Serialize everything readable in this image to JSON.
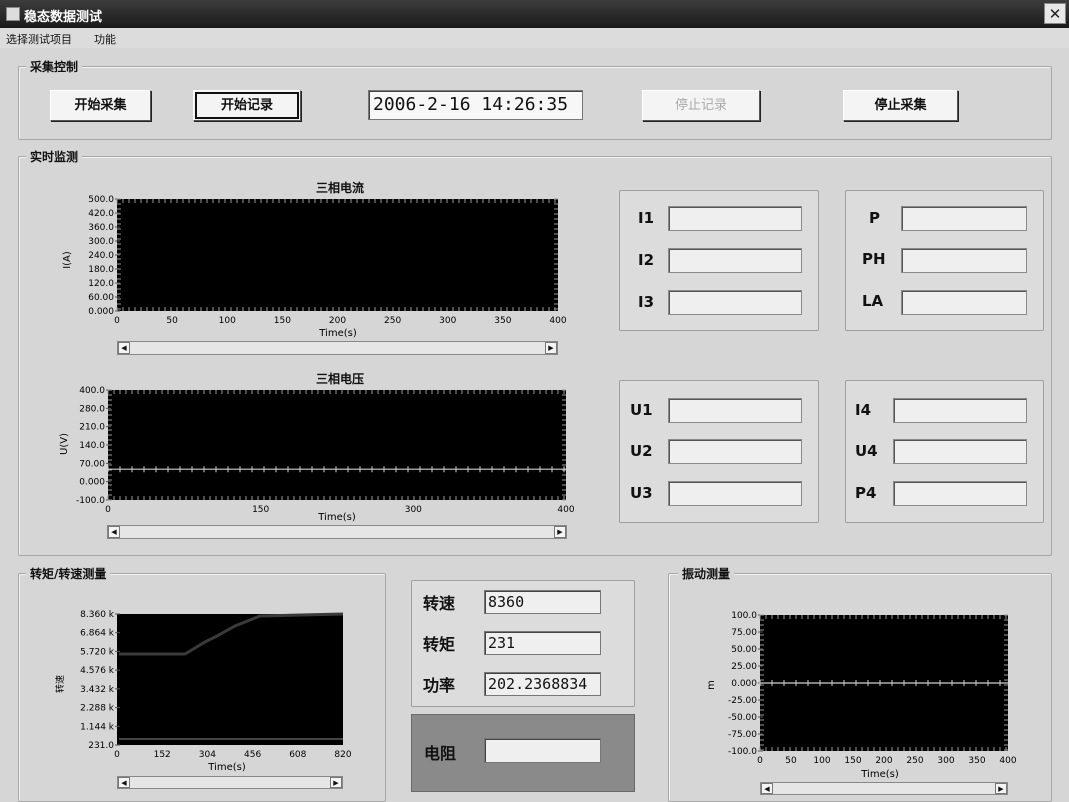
{
  "window": {
    "title": "稳态数据测试",
    "close_glyph": "✕"
  },
  "menu": {
    "items": [
      "选择测试项目",
      "功能"
    ]
  },
  "acquisition": {
    "group_label": "采集控制",
    "start_acquire": "开始采集",
    "start_record": "开始记录",
    "datetime": "2006-2-16 14:26:35",
    "stop_record": "停止记录",
    "stop_acquire": "停止采集"
  },
  "monitor": {
    "group_label": "实时监测",
    "current_chart": {
      "title": "三相电流",
      "ylabel": "I(A)",
      "xlabel": "Time(s)",
      "yticks": [
        "500.0",
        "420.0",
        "360.0",
        "300.0",
        "240.0",
        "180.0",
        "120.0",
        "60.00",
        "0.000"
      ],
      "xticks": [
        "0",
        "50",
        "100",
        "150",
        "200",
        "250",
        "300",
        "350",
        "400"
      ]
    },
    "voltage_chart": {
      "title": "三相电压",
      "ylabel": "U(V)",
      "xlabel": "Time(s)",
      "yticks": [
        "400.0",
        "280.0",
        "210.0",
        "140.0",
        "70.00",
        "0.000",
        "-100.0"
      ],
      "xticks": [
        "0",
        "150",
        "300",
        "400"
      ]
    },
    "current_fields": [
      {
        "label": "I1",
        "value": ""
      },
      {
        "label": "I2",
        "value": ""
      },
      {
        "label": "I3",
        "value": ""
      }
    ],
    "power_fields": [
      {
        "label": "P",
        "value": ""
      },
      {
        "label": "PH",
        "value": ""
      },
      {
        "label": "LA",
        "value": ""
      }
    ],
    "voltage_fields": [
      {
        "label": "U1",
        "value": ""
      },
      {
        "label": "U2",
        "value": ""
      },
      {
        "label": "U3",
        "value": ""
      }
    ],
    "extra_fields": [
      {
        "label": "I4",
        "value": ""
      },
      {
        "label": "U4",
        "value": ""
      },
      {
        "label": "P4",
        "value": ""
      }
    ]
  },
  "torque": {
    "group_label": "转矩/转速测量",
    "chart": {
      "ylabel": "转速",
      "xlabel": "Time(s)",
      "yticks": [
        "8.360 k",
        "6.864 k",
        "5.720 k",
        "4.576 k",
        "3.432 k",
        "2.288 k",
        "1.144 k",
        "231.0"
      ],
      "xticks": [
        "0",
        "152",
        "304",
        "456",
        "608",
        "820"
      ]
    },
    "speed_label": "转速",
    "speed_value": "8360",
    "torque_label": "转矩",
    "torque_value": "231",
    "power_label": "功率",
    "power_value": "202.2368834",
    "resistance_label": "电阻",
    "resistance_value": ""
  },
  "vibration": {
    "group_label": "振动测量",
    "chart": {
      "ylabel": "m",
      "xlabel": "Time(s)",
      "yticks": [
        "100.0",
        "75.00",
        "50.00",
        "25.00",
        "0.000",
        "-25.00",
        "-50.00",
        "-75.00",
        "-100.0"
      ],
      "xticks": [
        "0",
        "50",
        "100",
        "150",
        "200",
        "250",
        "300",
        "350",
        "400"
      ]
    }
  }
}
